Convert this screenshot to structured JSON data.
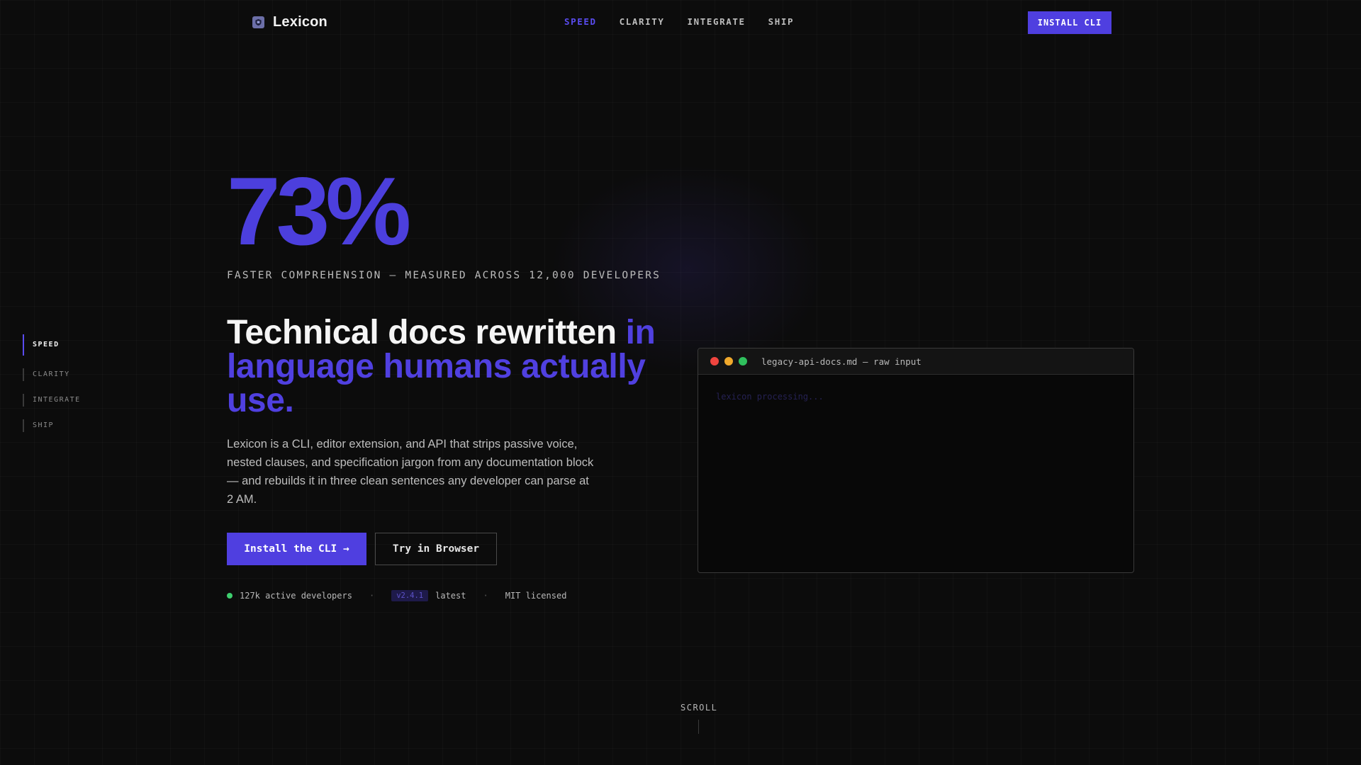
{
  "brand": {
    "name": "Lexicon",
    "icon": "shield-icon"
  },
  "nav": {
    "links": [
      "SPEED",
      "CLARITY",
      "INTEGRATE",
      "SHIP"
    ],
    "active": "SPEED",
    "cta_label": "INSTALL CLI"
  },
  "side_nav": {
    "items": [
      "SPEED",
      "CLARITY",
      "INTEGRATE",
      "SHIP"
    ],
    "active": "SPEED"
  },
  "hero": {
    "stat": "73%",
    "stat_caption": "FASTER COMPREHENSION — MEASURED ACROSS 12,000 DEVELOPERS",
    "headline_plain": "Technical docs rewritten ",
    "headline_accent": "in language humans actually use.",
    "lede": "Lexicon is a CLI, editor extension, and API that strips passive voice, nested clauses, and specification jargon from any documentation block — and rebuilds it in three clean sentences any developer can parse at 2 AM.",
    "primary_button": "Install the CLI →",
    "secondary_button": "Try in Browser"
  },
  "meta": {
    "developers": "127k active developers",
    "separator": "·",
    "version": "v2.4.1",
    "version_suffix": "latest",
    "license": "MIT licensed"
  },
  "terminal": {
    "title": "legacy-api-docs.md — raw input",
    "line": "lexicon processing..."
  },
  "scroll": {
    "label": "SCROLL"
  },
  "colors": {
    "accent": "#4f3fe0",
    "background": "#0c0c0c",
    "status_green": "#3ecf6e"
  }
}
